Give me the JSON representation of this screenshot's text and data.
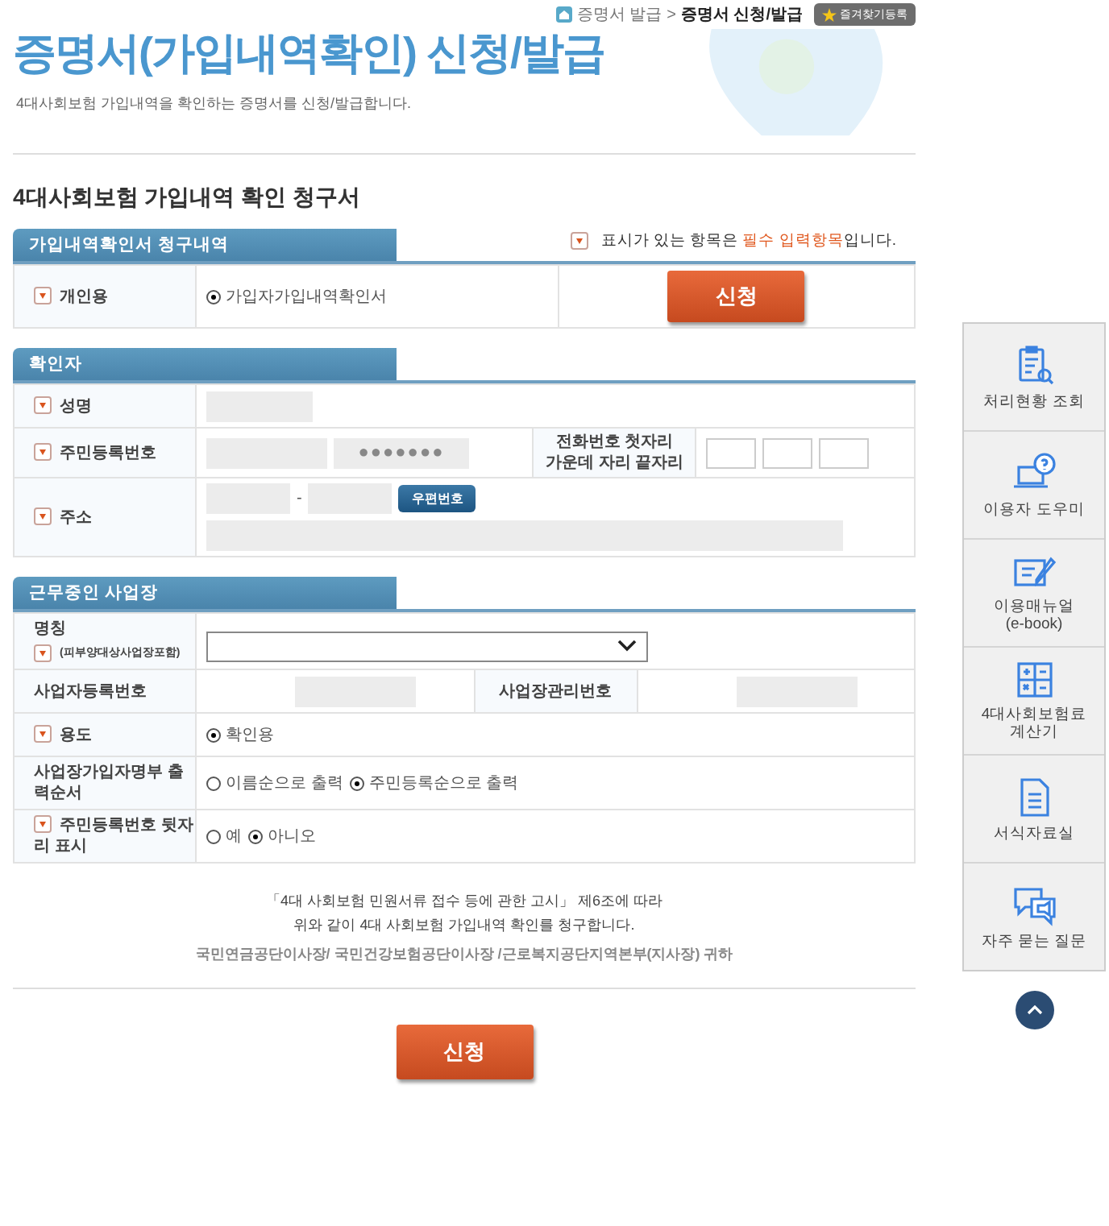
{
  "breadcrumb": {
    "items": [
      "증명서 발급",
      "증명서 신청/발급"
    ],
    "separator": ">",
    "favorite_button": "즐겨찾기등록"
  },
  "title": "증명서(가입내역확인) 신청/발급",
  "subtitle": "4대사회보험 가입내역을 확인하는 증명서를 신청/발급합니다.",
  "form_title": "4대사회보험 가입내역 확인 청구서",
  "required_note": {
    "before": "표시가 있는 항목은 ",
    "highlight": "필수 입력항목",
    "after": "입니다."
  },
  "sections": [
    {
      "title": "가입내역확인서 청구내역",
      "rows": [
        {
          "kind": "radio",
          "label": "개인용",
          "required": true,
          "options": [
            {
              "label": "가입자가입내역확인서",
              "selected": true
            }
          ],
          "button": "신청"
        }
      ]
    },
    {
      "title": "확인자",
      "rows": [
        {
          "kind": "text",
          "label": "성명",
          "required": true
        },
        {
          "kind": "resident",
          "label": "주민등록번호",
          "required": true,
          "mask": "●●●●●●●",
          "phone_label": [
            "전화번호 첫자리",
            "가운데 자리 끝자리"
          ]
        },
        {
          "kind": "address",
          "label": "주소",
          "required": true,
          "dash": "-",
          "button": "우편번호"
        }
      ]
    },
    {
      "title": "근무중인 사업장",
      "rows": [
        {
          "kind": "select",
          "label": "명칭",
          "sublabel": "(피부양대상사업장포함)",
          "required": true
        },
        {
          "kind": "pair",
          "label": "사업자등록번호",
          "required": false,
          "label2": "사업장관리번호"
        },
        {
          "kind": "radio",
          "label": "용도",
          "required": true,
          "options": [
            {
              "label": "확인용",
              "selected": true
            }
          ]
        },
        {
          "kind": "radio",
          "label": "사업장가입자명부 출력순서",
          "required": false,
          "options": [
            {
              "label": "이름순으로 출력",
              "selected": false
            },
            {
              "label": "주민등록순으로 출력",
              "selected": true
            }
          ]
        },
        {
          "kind": "radio",
          "label": "주민등록번호 뒷자리 표시",
          "required": true,
          "options": [
            {
              "label": "예",
              "selected": false
            },
            {
              "label": "아니오",
              "selected": true
            }
          ]
        }
      ]
    }
  ],
  "notice": [
    "「4대 사회보험 민원서류 접수 등에 관한 고시」 제6조에 따라",
    "위와 같이 4대 사회보험 가입내역 확인를 청구합니다."
  ],
  "addressee": "국민연금공단이사장/ 국민건강보험공단이사장 /근로복지공단지역본부(지사장) 귀하",
  "submit_button": "신청",
  "sidebar": [
    {
      "kind": "clipboard",
      "lines": [
        "처리현황 조회"
      ]
    },
    {
      "kind": "help",
      "lines": [
        "이용자 도우미"
      ]
    },
    {
      "kind": "manual",
      "lines": [
        "이용매뉴얼",
        "(e-book)"
      ]
    },
    {
      "kind": "calculator",
      "lines": [
        "4대사회보험료",
        "계산기"
      ]
    },
    {
      "kind": "document",
      "lines": [
        "서식자료실"
      ]
    },
    {
      "kind": "faq",
      "lines": [
        "자주 묻는 질문"
      ]
    }
  ]
}
